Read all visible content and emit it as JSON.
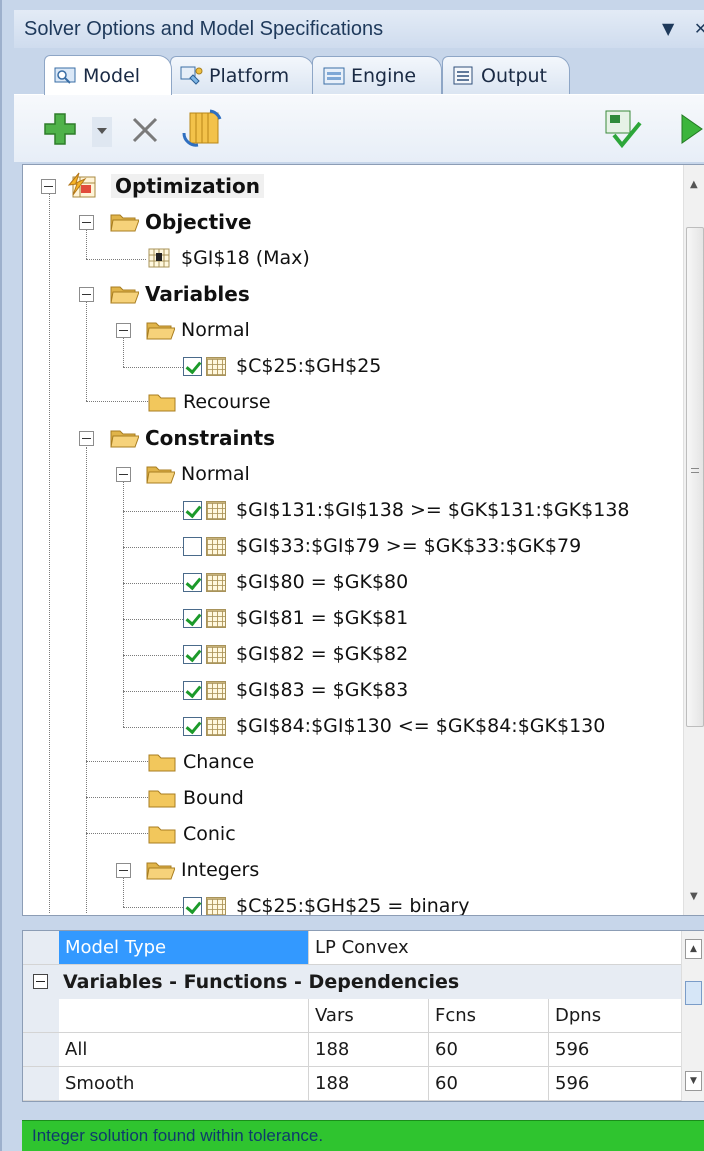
{
  "panel": {
    "title": "Solver Options and Model Specifications",
    "dropdown_icon": "triangle-down-icon",
    "close_icon": "close-icon"
  },
  "tabs": [
    {
      "label": "Model",
      "icon": "model-icon",
      "active": true
    },
    {
      "label": "Platform",
      "icon": "platform-icon",
      "active": false
    },
    {
      "label": "Engine",
      "icon": "engine-icon",
      "active": false
    },
    {
      "label": "Output",
      "icon": "output-icon",
      "active": false
    }
  ],
  "toolbar": {
    "add": "plus-icon",
    "dropdown": "chevron-down-icon",
    "delete": "x-icon",
    "refresh": "refresh-icon",
    "analyze": "analyze-icon",
    "solve": "play-icon"
  },
  "tree": {
    "root": "Optimization",
    "objective": {
      "label": "Objective",
      "item": "$GI$18 (Max)"
    },
    "variables": {
      "label": "Variables",
      "normal": "Normal",
      "normal_items": [
        "$C$25:$GH$25"
      ],
      "recourse": "Recourse"
    },
    "constraints": {
      "label": "Constraints",
      "normal": "Normal",
      "normal_items": [
        {
          "text": "$GI$131:$GI$138 >= $GK$131:$GK$138",
          "checked": true
        },
        {
          "text": "$GI$33:$GI$79 >= $GK$33:$GK$79",
          "checked": false
        },
        {
          "text": "$GI$80 = $GK$80",
          "checked": true
        },
        {
          "text": "$GI$81 = $GK$81",
          "checked": true
        },
        {
          "text": "$GI$82 = $GK$82",
          "checked": true
        },
        {
          "text": "$GI$83 = $GK$83",
          "checked": true
        },
        {
          "text": "$GI$84:$GI$130 <= $GK$84:$GK$130",
          "checked": true
        }
      ],
      "chance": "Chance",
      "bound": "Bound",
      "conic": "Conic",
      "integers": "Integers",
      "integer_items": [
        {
          "text": "$C$25:$GH$25 = binary",
          "checked": true
        }
      ]
    }
  },
  "properties": {
    "model_type_label": "Model Type",
    "model_type_value": "LP Convex",
    "section_title": "Variables - Functions - Dependencies",
    "headers": [
      "",
      "Vars",
      "Fcns",
      "Dpns"
    ],
    "rows": [
      [
        "All",
        "188",
        "60",
        "596"
      ],
      [
        "Smooth",
        "188",
        "60",
        "596"
      ]
    ]
  },
  "status": "Integer solution found within tolerance."
}
